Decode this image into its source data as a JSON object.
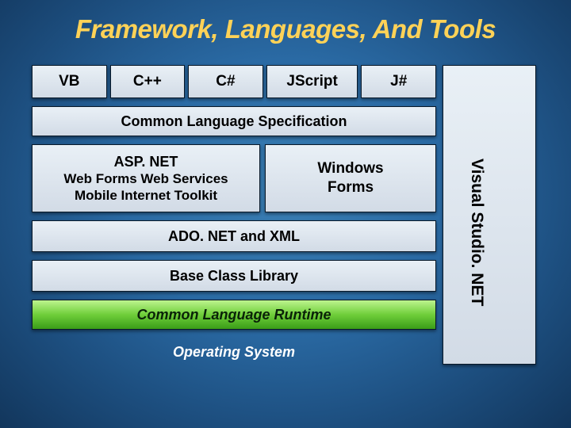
{
  "title": "Framework, Languages, And Tools",
  "languages": [
    "VB",
    "C++",
    "C#",
    "JScript",
    "J#"
  ],
  "cls": "Common Language Specification",
  "aspnet": {
    "line1": "ASP. NET",
    "line2": "Web Forms   Web Services",
    "line3": "Mobile Internet Toolkit"
  },
  "winforms": {
    "line1": "Windows",
    "line2": "Forms"
  },
  "ado": "ADO. NET and XML",
  "bcl": "Base Class Library",
  "clr": "Common Language Runtime",
  "os": "Operating System",
  "vs": "Visual Studio. NET"
}
